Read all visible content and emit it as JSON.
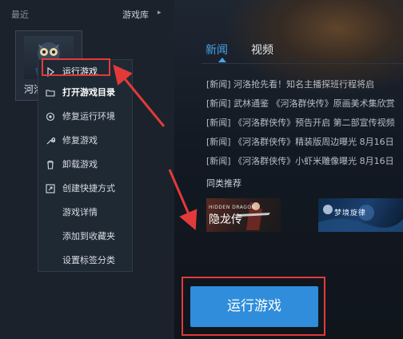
{
  "sidebar": {
    "recent_label": "最近",
    "library_label": "游戏库",
    "library_arrow": "▸",
    "game_tile_name": "河洛"
  },
  "main": {
    "tabs": [
      {
        "label": "新闻",
        "active": true
      },
      {
        "label": "视频",
        "active": false
      }
    ],
    "news": [
      "[新闻] 河洛抢先看！知名主播探班行程将启",
      "[新闻] 武林通鉴 《河洛群侠传》原画美术集欣赏",
      "[新闻] 《河洛群侠传》预告开启 第二部宣传视频",
      "[新闻] 《河洛群侠传》精装版周边曝光 8月16日",
      "[新闻] 《河洛群侠传》小虾米雕像曝光 8月16日"
    ],
    "similar_label": "同类推荐",
    "similar_games": [
      {
        "line1": "HIDDEN DRAGON",
        "line2": "隐龙传"
      },
      {
        "title": "梦境旋律"
      }
    ],
    "run_button_label": "运行游戏"
  },
  "context_menu": {
    "items": [
      {
        "label": "运行游戏",
        "icon": "play-icon"
      },
      {
        "label": "打开游戏目录",
        "icon": "folder-icon"
      },
      {
        "label": "修复运行环境",
        "icon": "gear-icon"
      },
      {
        "label": "修复游戏",
        "icon": "wrench-icon"
      },
      {
        "label": "卸载游戏",
        "icon": "trash-icon"
      },
      {
        "label": "创建快捷方式",
        "icon": "shortcut-icon"
      },
      {
        "label": "游戏详情",
        "icon": ""
      },
      {
        "label": "添加到收藏夹",
        "icon": ""
      },
      {
        "label": "设置标签分类",
        "icon": ""
      }
    ]
  },
  "colors": {
    "accent": "#2f8ddb",
    "tab_active": "#4aa3e6",
    "annotation_red": "#e23a3a"
  }
}
